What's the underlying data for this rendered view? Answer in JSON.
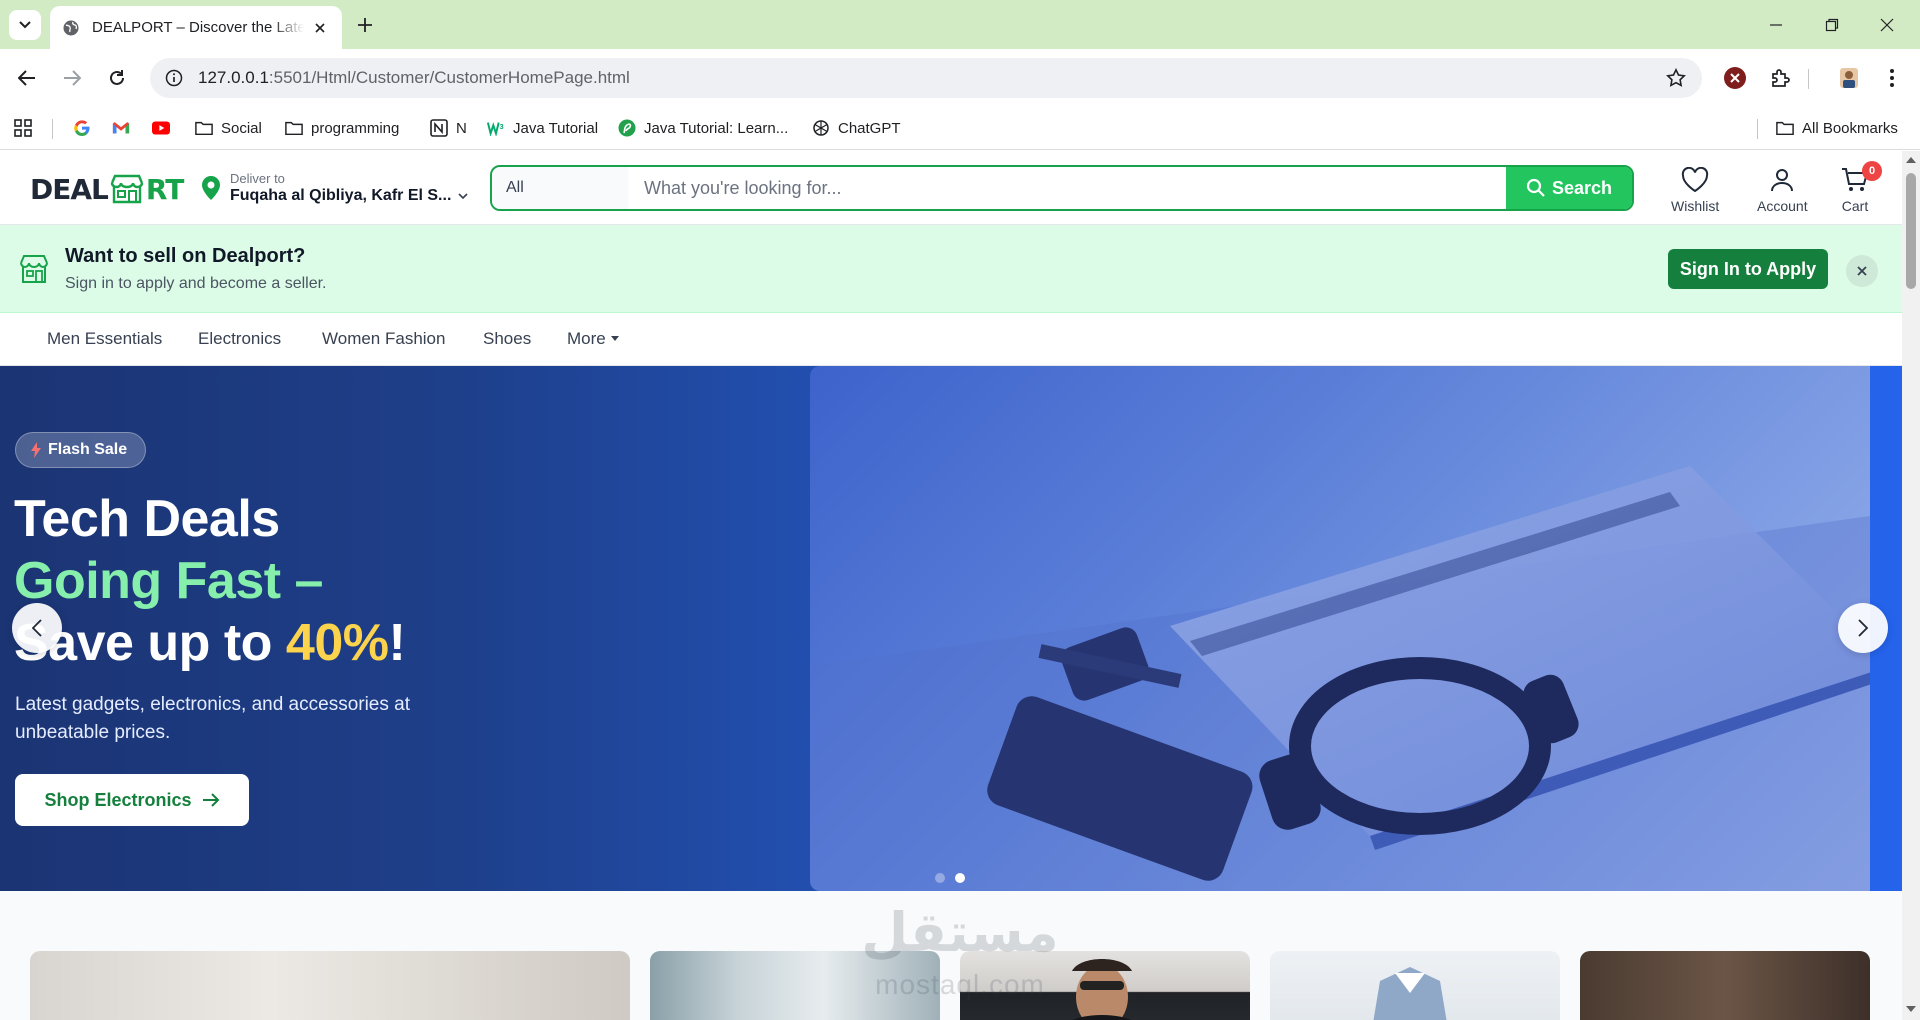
{
  "browser": {
    "tab_title": "DEALPORT – Discover the Latest",
    "url_host": "127.0.0.1",
    "url_path": ":5501/Html/Customer/CustomerHomePage.html",
    "bookmarks": [
      {
        "label": "",
        "icon": "google-icon"
      },
      {
        "label": "",
        "icon": "gmail-icon"
      },
      {
        "label": "",
        "icon": "youtube-icon"
      },
      {
        "label": "Social",
        "icon": "folder-icon"
      },
      {
        "label": "programming",
        "icon": "folder-icon"
      },
      {
        "label": "N",
        "icon": "notion-icon"
      },
      {
        "label": "Java Tutorial",
        "icon": "w3schools-icon"
      },
      {
        "label": "Java Tutorial: Learn...",
        "icon": "site-icon"
      },
      {
        "label": "ChatGPT",
        "icon": "chatgpt-icon"
      }
    ],
    "all_bookmarks": "All Bookmarks"
  },
  "header": {
    "logo_left": "DEAL",
    "logo_right": "RT",
    "deliver_label": "Deliver to",
    "deliver_location": "Fuqaha al Qibliya, Kafr El S...",
    "search_category": "All",
    "search_placeholder": "What you're looking for...",
    "search_button": "Search",
    "wishlist": "Wishlist",
    "account": "Account",
    "cart": "Cart",
    "cart_count": "0"
  },
  "seller_banner": {
    "title": "Want to sell on Dealport?",
    "subtitle": "Sign in to apply and become a seller.",
    "button": "Sign In to Apply"
  },
  "categories": [
    "Men Essentials",
    "Electronics",
    "Women Fashion",
    "Shoes",
    "More"
  ],
  "hero": {
    "badge": "Flash Sale",
    "line1": "Tech Deals",
    "line2": "Going Fast –",
    "line3_prefix": "Save up to ",
    "line3_accent": "40%",
    "line3_suffix": "!",
    "description": "Latest gadgets, electronics, and accessories at unbeatable prices.",
    "cta": "Shop Electronics",
    "slides_total": 2,
    "active_slide": 2
  },
  "watermark": {
    "arabic": "مستقل",
    "latin": "mostaql.com"
  },
  "colors": {
    "brand_green": "#16a34a",
    "hero_blue": "#1f3f82",
    "accent_yellow": "#fcd34d"
  }
}
